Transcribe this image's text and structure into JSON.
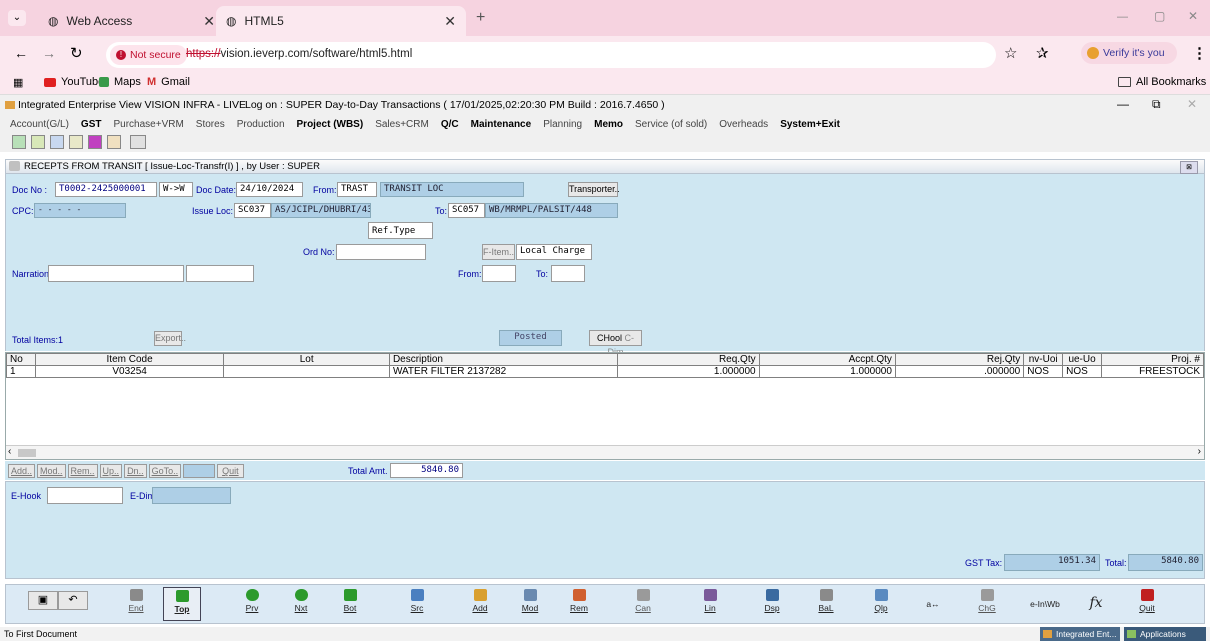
{
  "browser": {
    "tabs": [
      {
        "label": "Web Access"
      },
      {
        "label": "HTML5"
      }
    ],
    "new_tab": "+",
    "window_controls": {
      "minimize": "—",
      "restore": "▢",
      "close": "✕"
    },
    "address": {
      "security": "Not secure",
      "url_scheme": "https://",
      "url_rest": "vision.ieverp.com/software/html5.html"
    },
    "verify": "Verify it's you",
    "bookmarks": [
      "YouTube",
      "Maps",
      "Gmail"
    ],
    "all_bookmarks": "All Bookmarks"
  },
  "app": {
    "title": "Integrated Enterprise View  VISION INFRA - LIVE",
    "logon": "Log on : SUPER  Day-to-Day Transactions ( 17/01/2025,02:20:30 PM Build : 2016.7.4650 )",
    "menus": [
      "Account(G/L)",
      "GST",
      "Purchase+VRM",
      "Stores",
      "Production",
      "Project (WBS)",
      "Sales+CRM",
      "Q/C",
      "Maintenance",
      "Planning",
      "Memo",
      "Service (of sold)",
      "Overheads",
      "System+Exit"
    ],
    "bold_menus": [
      "GST",
      "Project (WBS)",
      "Q/C",
      "Maintenance",
      "Memo",
      "System+Exit"
    ]
  },
  "form": {
    "title": "RECEPTS FROM TRANSIT  [ Issue-Loc-Transfr(I) ] , by User : SUPER",
    "doc_no_label": "Doc No :",
    "doc_no": "T0002-2425000001",
    "direction": "W->W",
    "doc_date_label": "Doc Date:",
    "doc_date": "24/10/2024",
    "from_label": "From:",
    "from_code": "TRAST",
    "from_name": "TRANSIT LOC",
    "transporter": "Transporter..",
    "cpc_label": "CPC:",
    "cpc_value": "-  -  -  -       -",
    "issue_loc_label": "Issue Loc:",
    "issue_loc_code": "SC037",
    "issue_loc_name": "AS/JCIPL/DHUBRI/43",
    "to_label": "To:",
    "to_code": "SC057",
    "to_name": "WB/MRMPL/PALSIT/448",
    "ref_type": "Ref.Type",
    "ord_no_label": "Ord No:",
    "f_item": "F-Item..",
    "local_charge": "Local Charge",
    "narration_label": "Narration:",
    "from2_label": "From:",
    "to2_label": "To:",
    "total_items": "Total Items:1",
    "export": "Export..",
    "posted": "Posted",
    "chool": "CHool",
    "cdim": "C-Dim"
  },
  "grid": {
    "columns": [
      "No",
      "Item Code",
      "Lot",
      "Description",
      "Req.Qty",
      "Accpt.Qty",
      "Rej.Qty",
      "nv-Uoi",
      "ue-Uo",
      "Proj. #"
    ],
    "rows": [
      [
        "1",
        "V03254",
        "",
        "WATER FILTER 2137282",
        "1.000000",
        "1.000000",
        ".000000",
        "NOS",
        "NOS",
        "FREESTOCK"
      ]
    ]
  },
  "actions": {
    "buttons": [
      "Add..",
      "Mod..",
      "Rem..",
      "Up..",
      "Dn..",
      "GoTo..",
      "Quit"
    ],
    "total_amt_label": "Total Amt.",
    "total_amt": "5840.80"
  },
  "lower": {
    "ehook_label": "E-Hook",
    "edim_label": "E-Dim",
    "gst_tax_label": "GST Tax:",
    "gst_tax": "1051.34",
    "total_label": "Total:",
    "total": "5840.80"
  },
  "footer": {
    "buttons": [
      "End",
      "Top",
      "Prv",
      "Nxt",
      "Bot",
      "Src",
      "Add",
      "Mod",
      "Rem",
      "Can",
      "Lin",
      "Dsp",
      "BaL",
      "Qlp",
      "a↔",
      "ChG",
      "e-In\\Wb",
      "fx",
      "Quit"
    ],
    "icon_colors": [
      "#8a8a8a",
      "#2c9a2c",
      "#2c9a2c",
      "#2c9a2c",
      "#2c9a2c",
      "#4a7fc0",
      "#d9a030",
      "#6a8ab0",
      "#d06030",
      "#9a9a9a",
      "#7a5a9a",
      "#3a6aa0",
      "#8a8a8a",
      "#5a8ac0",
      "#555555",
      "#9a9a9a",
      "#333333",
      "#333333",
      "#c02020"
    ]
  },
  "status": {
    "left": "To First Document",
    "task1": "Integrated Ent...",
    "task2": "Applications"
  }
}
